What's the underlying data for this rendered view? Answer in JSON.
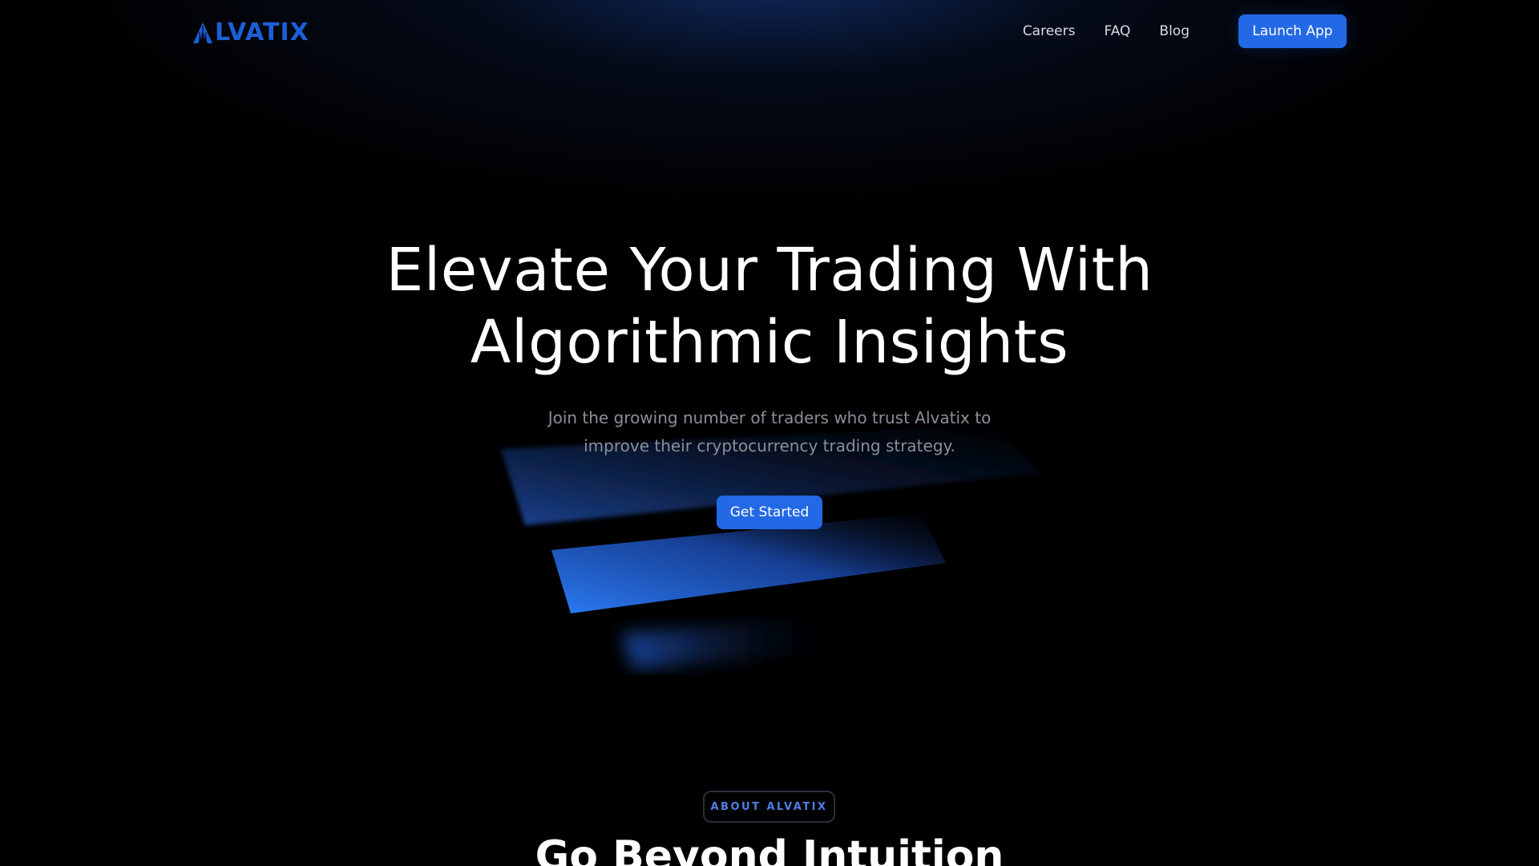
{
  "nav": {
    "logo_text": "LVATIX",
    "logo_icon": "alvatix-a-mark",
    "links": [
      "Careers",
      "FAQ",
      "Blog"
    ],
    "launch_label": "Launch App"
  },
  "hero": {
    "title_line1": "Elevate Your Trading With",
    "title_line2": "Algorithmic Insights",
    "subtitle_line1": "Join the growing number of traders who trust Alvatix to",
    "subtitle_line2": "improve their cryptocurrency trading strategy.",
    "cta_label": "Get Started"
  },
  "about": {
    "badge": "ABOUT ALVATIX",
    "title": "Go Beyond Intuition"
  },
  "colors": {
    "accent": "#2369e6",
    "logo": "#1c5fd6",
    "background": "#000000",
    "subtitle_text": "#8a8e98",
    "badge_text": "#4f7fe6"
  }
}
